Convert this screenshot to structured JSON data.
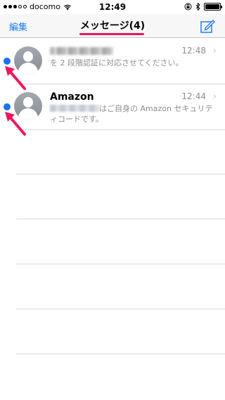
{
  "status_bar": {
    "carrier": "docomo",
    "time": "12:49"
  },
  "nav": {
    "edit_label": "編集",
    "title": "メッセージ(4)"
  },
  "messages": [
    {
      "sender_blurred": true,
      "sender": "",
      "time": "12:48",
      "preview": "を 2 段階認証に対応させてください。",
      "unread": true
    },
    {
      "sender_blurred": false,
      "sender": "Amazon",
      "time": "12:44",
      "preview": "はご自身の Amazon セキュリティコードです。",
      "unread": true
    }
  ],
  "colors": {
    "accent": "#1a7cf0",
    "unread_dot": "#1574f0",
    "annotation": "#f0165c"
  }
}
